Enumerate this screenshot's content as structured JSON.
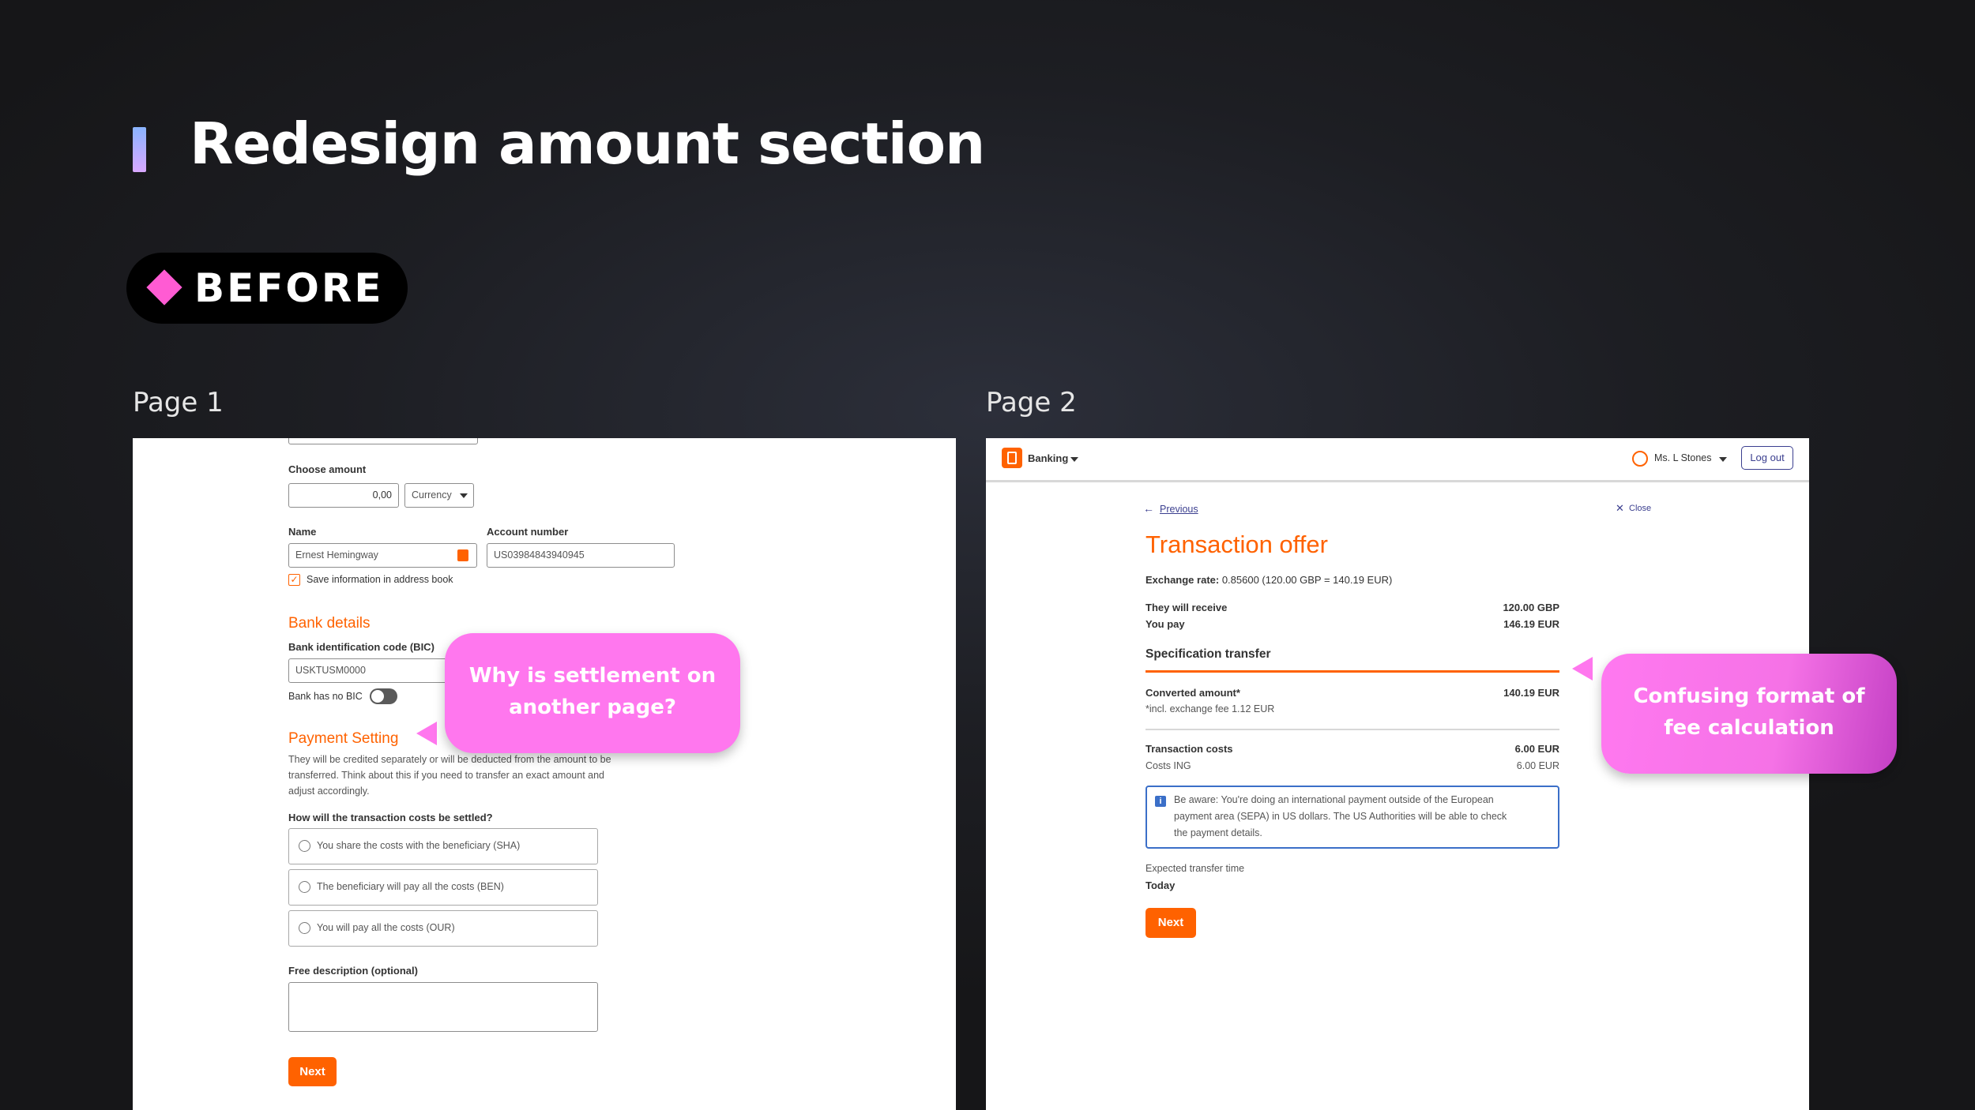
{
  "headline": "Redesign amount section",
  "badge": "BEFORE",
  "colors": {
    "accent": "#ff6200",
    "bubble": "#ff77ee",
    "diamond": "#ff5bd3",
    "info": "#3b6fc8"
  },
  "page1": {
    "label": "Page 1",
    "choose_amount_label": "Choose amount",
    "amount_value": "0,00",
    "currency_label": "Currency",
    "name_label": "Name",
    "name_value": "Ernest Hemingway",
    "account_label": "Account number",
    "account_value": "US03984843940945",
    "save_label": "Save information in address book",
    "bank_details_heading": "Bank details",
    "bic_label": "Bank identification code (BIC)",
    "bic_value": "USKTUSM0000",
    "no_bic_label": "Bank has no BIC",
    "payment_heading": "Payment Setting",
    "payment_desc_1": "They will be credited separately or will be deducted from the amount to be",
    "payment_desc_2": "transferred. Think about this if you need to transfer an exact amount and",
    "payment_desc_3": "adjust accordingly.",
    "question": "How will the transaction costs be settled?",
    "options": [
      "You share the costs with the beneficiary (SHA)",
      "The beneficiary will pay all the costs (BEN)",
      "You will pay all the costs (OUR)"
    ],
    "free_desc_label": "Free description (optional)",
    "next_label": "Next",
    "annotation_1": "Why is settlement on",
    "annotation_2": "another page?"
  },
  "page2": {
    "label": "Page 2",
    "nav_banking": "Banking",
    "user_name": "Ms. L Stones",
    "logout_label": "Log out",
    "previous_label": "Previous",
    "close_label": "Close",
    "title": "Transaction offer",
    "exchange_label": "Exchange rate:",
    "exchange_value": "0.85600 (120.00 GBP = 140.19 EUR)",
    "receive_label": "They will receive",
    "receive_value": "120.00 GBP",
    "pay_label": "You pay",
    "pay_value": "146.19 EUR",
    "spec_heading": "Specification transfer",
    "converted_label": "Converted amount*",
    "converted_value": "140.19 EUR",
    "converted_note": "*incl. exchange fee 1.12 EUR",
    "tx_costs_label": "Transaction costs",
    "tx_costs_value": "6.00 EUR",
    "costs_ing_label": "Costs ING",
    "costs_ing_value": "6.00 EUR",
    "info_1": "Be aware: You're doing an international payment outside of the European",
    "info_2": "payment area (SEPA) in US dollars. The US Authorities will be able to check",
    "info_3": "the payment details.",
    "expected_label": "Expected transfer time",
    "expected_value": "Today",
    "next_label": "Next",
    "annotation_1": "Confusing format of",
    "annotation_2": "fee calculation"
  }
}
